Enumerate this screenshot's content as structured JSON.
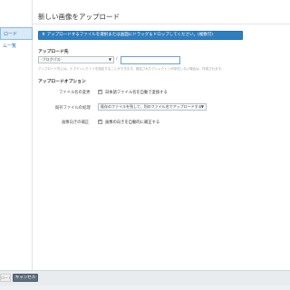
{
  "sidebar": {
    "items": [
      {
        "label": "ロード"
      },
      {
        "label": "ム一覧"
      }
    ]
  },
  "main": {
    "title": "新しい画像をアップロード",
    "upload_prompt": "アップロードするファイルを選択または画面にドラッグ＆ドロップしてください。(複数可)",
    "upload_icon": "⬆",
    "destination": {
      "label": "アップロード先",
      "root_select": "-ブログパス-",
      "separator": "/",
      "path_value": "",
      "help": "アップロード先には、ナブディレクトリを指定することができます。指定されたディレクトリが存在しない場合は、作成されます。"
    },
    "options": {
      "label": "アップロードオプション",
      "rename": {
        "label": "ファイル名の変更",
        "text": "日本語ファイル名を自動で変換する"
      },
      "existing": {
        "label": "既存ファイルの処理",
        "select": "既存のファイルを残して、別のファイル名でアップロードする"
      },
      "orientation": {
        "label": "画像向きの補正",
        "text": "画像の向きを自動的に補正する"
      }
    }
  },
  "footer": {
    "upload_button": "ロード",
    "cancel_button": "キャンセル"
  }
}
